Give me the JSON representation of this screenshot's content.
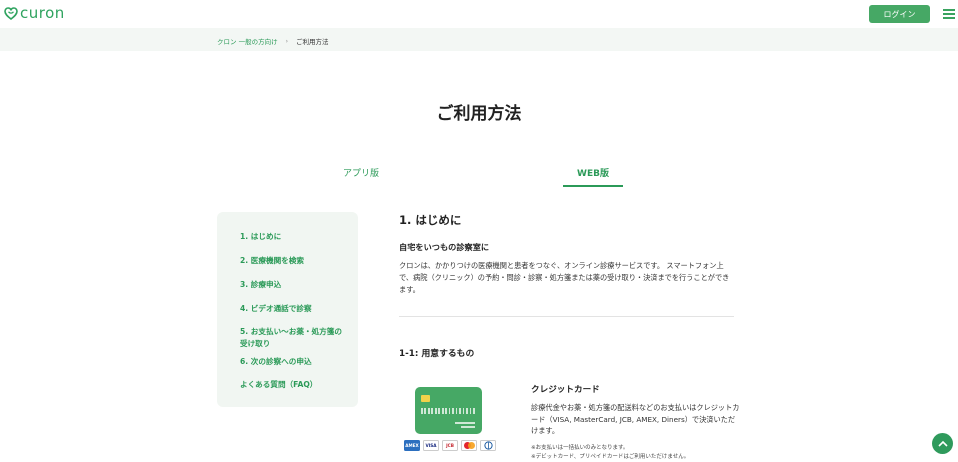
{
  "header": {
    "logo_text": "curon",
    "login_label": "ログイン",
    "brand_color": "#2fa35f",
    "icons": [
      "heart-logo-icon",
      "hamburger-menu-icon"
    ]
  },
  "breadcrumb": {
    "items": [
      "クロン 一般の方向け",
      "ご利用方法"
    ],
    "separator": "›"
  },
  "page": {
    "title": "ご利用方法",
    "tabs": [
      {
        "label": "アプリ版",
        "active": false
      },
      {
        "label": "WEB版",
        "active": true
      }
    ]
  },
  "sidebar": {
    "items": [
      "1. はじめに",
      "2. 医療機関を検索",
      "3. 診療申込",
      "4. ビデオ通話で診察",
      "5. お支払い〜お薬・処方箋の受け取り",
      "6. 次の診察への申込",
      "よくある質問（FAQ）"
    ]
  },
  "main": {
    "section_title": "1. はじめに",
    "subtitle": "自宅をいつもの診察室に",
    "paragraph": "クロンは、かかりつけの医療機関と患者をつなぐ、オンライン診療サービスです。 スマートフォン上で、病院（クリニック）の予約・問診・診察・処方箋または薬の受け取り・決済までを行うことができます。",
    "section2_title": "1-1: 用意するもの",
    "card": {
      "title": "クレジットカード",
      "description": "診療代金やお薬・処方箋の配送料などのお支払いはクレジットカード（VISA, MasterCard, JCB, AMEX, Diners）で決済いただけます。",
      "note1": "※お支払いは一括払いのみとなります。",
      "note2": "※デビットカード、プリペイドカードはご利用いただけません。",
      "brands": [
        "AMEX",
        "VISA",
        "JCB",
        "MasterCard",
        "Diners"
      ]
    }
  },
  "scroll_top": {
    "icon": "chevron-up-icon"
  }
}
